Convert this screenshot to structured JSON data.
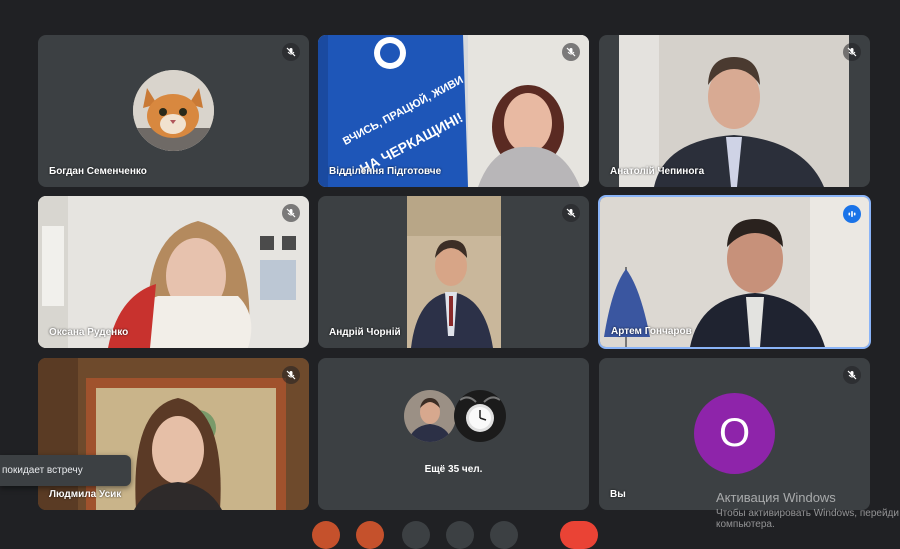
{
  "participants": [
    {
      "name": "Богдан Семенченко"
    },
    {
      "name": "Відділення Підготовче"
    },
    {
      "name": "Анатолій Чепинога"
    },
    {
      "name": "Оксана Руденко"
    },
    {
      "name": "Андрій Чорній"
    },
    {
      "name": "Артем Гончаров"
    },
    {
      "name": "Людмила Усик"
    },
    {
      "name": "Вы",
      "avatar_letter": "O",
      "avatar_color": "#8e24aa"
    }
  ],
  "banner": {
    "line1": "ВЧИСЬ, ПРАЦЮЙ, ЖИВИ",
    "line2": "НА ЧЕРКАЩИНІ!"
  },
  "more": {
    "label": "Ещё 35 чел."
  },
  "toast": {
    "text": "покидает встречу"
  },
  "watermark": {
    "title": "Активация Windows",
    "subtitle": "Чтобы активировать Windows, перейди",
    "subtitle2": "компьютера."
  },
  "colors": {
    "background": "#202124",
    "tile": "#3c4043",
    "active_border": "#8ab4f8",
    "speaking_badge": "#1a73e8"
  }
}
